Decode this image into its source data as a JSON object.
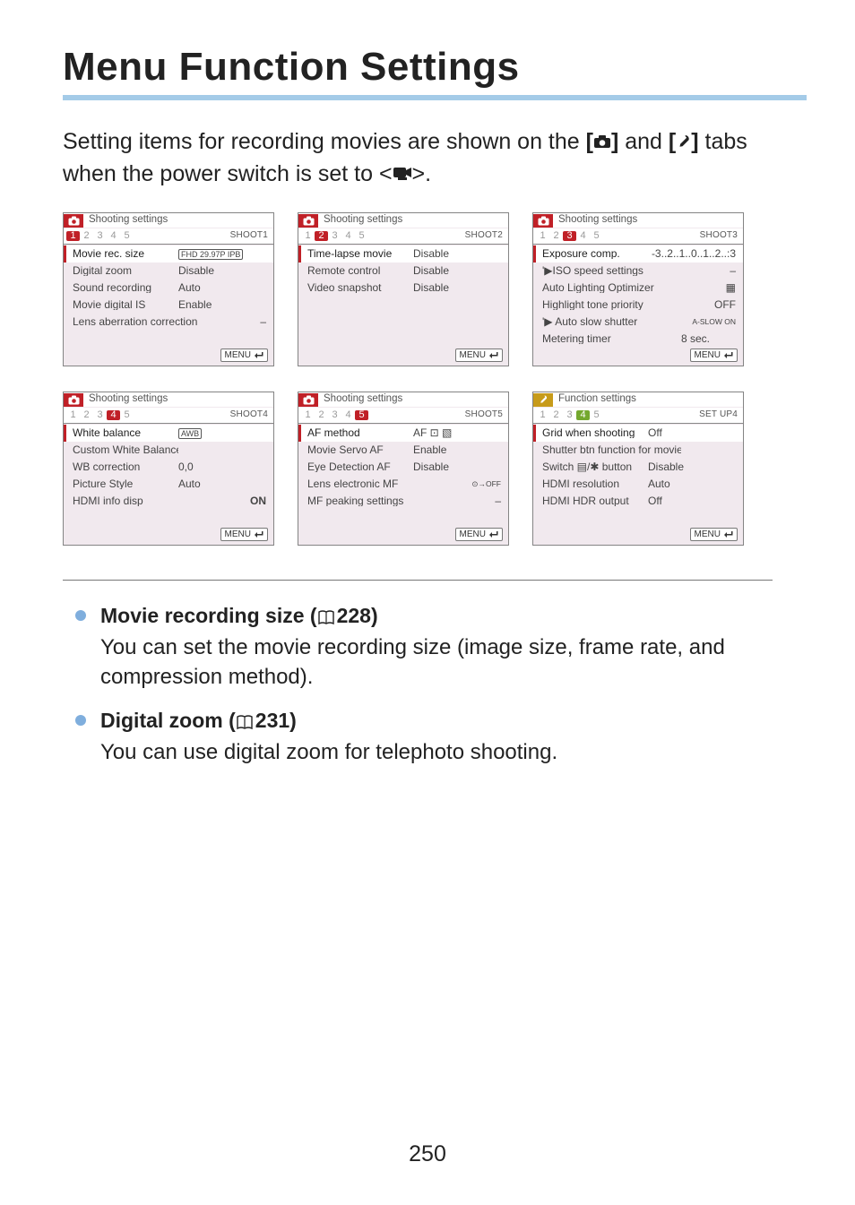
{
  "page_title": "Menu Function Settings",
  "intro": {
    "pre": "Setting items for recording movies are shown on the ",
    "bracket1_open": "[",
    "bracket1_close": "]",
    "mid": " and ",
    "bracket2_open": "[",
    "bracket2_close": "]",
    "after_brackets": " tabs when the power switch is set to <",
    "end": ">."
  },
  "panels": [
    {
      "header_icon_color": "red",
      "header_title": "Shooting settings",
      "active_tab_index": 0,
      "active_tab_style": "sel",
      "tab_label": "SHOOT1",
      "items": [
        {
          "k": "Movie rec. size",
          "v": "FHD 29.97P IPB",
          "v_style": "badge",
          "selected": true
        },
        {
          "k": "Digital zoom",
          "v": "Disable"
        },
        {
          "k": "Sound recording",
          "v": "Auto"
        },
        {
          "k": "Movie digital IS",
          "v": "Enable"
        },
        {
          "k": "Lens aberration correction",
          "v": "–",
          "v_align": "right",
          "wide_key": true
        }
      ],
      "footer": "MENU"
    },
    {
      "header_icon_color": "red",
      "header_title": "Shooting settings",
      "active_tab_index": 1,
      "active_tab_style": "sel",
      "tab_label": "SHOOT2",
      "items": [
        {
          "k": "Time-lapse movie",
          "v": "Disable",
          "selected": true
        },
        {
          "k": "Remote control",
          "v": "Disable"
        },
        {
          "k": "Video snapshot",
          "v": "Disable"
        }
      ],
      "footer": "MENU"
    },
    {
      "header_icon_color": "red",
      "header_title": "Shooting settings",
      "active_tab_index": 2,
      "active_tab_style": "sel",
      "tab_label": "SHOOT3",
      "items": [
        {
          "k": "Exposure comp.",
          "v": "-3..2..1..0..1..2..:3",
          "v_align": "right",
          "selected": true
        },
        {
          "k": "'▶ISO speed settings",
          "v": "–",
          "v_align": "right",
          "wide_key": true
        },
        {
          "k": "Auto Lighting Optimizer",
          "v": "▦",
          "v_align": "right",
          "wide_key": true
        },
        {
          "k": "Highlight tone priority",
          "v": "OFF",
          "v_align": "right",
          "wide_key": true
        },
        {
          "k": "'▶ Auto slow shutter",
          "v": "A-SLOW ON",
          "v_align": "right",
          "v_small": true,
          "wide_key": true
        },
        {
          "k": "Metering timer",
          "v": "8 sec.",
          "wide_key": true
        }
      ],
      "footer": "MENU"
    },
    {
      "header_icon_color": "red",
      "header_title": "Shooting settings",
      "active_tab_index": 3,
      "active_tab_style": "sel",
      "tab_label": "SHOOT4",
      "items": [
        {
          "k": "White balance",
          "v": "AWB",
          "v_style": "badge",
          "selected": true
        },
        {
          "k": "Custom White Balance",
          "v": ""
        },
        {
          "k": "WB correction",
          "v": "0,0"
        },
        {
          "k": "Picture Style",
          "v": "Auto"
        },
        {
          "k": "HDMI info disp",
          "v": "ON",
          "v_align": "right",
          "v_bold": true
        }
      ],
      "footer": "MENU"
    },
    {
      "header_icon_color": "red",
      "header_title": "Shooting settings",
      "active_tab_index": 4,
      "active_tab_style": "sel",
      "tab_label": "SHOOT5",
      "items": [
        {
          "k": "AF method",
          "v": "AF ⊡ ▧",
          "selected": true
        },
        {
          "k": "Movie Servo AF",
          "v": "Enable"
        },
        {
          "k": "Eye Detection AF",
          "v": "Disable"
        },
        {
          "k": "Lens electronic MF",
          "v": "⊙→OFF",
          "v_align": "right",
          "v_small": true
        },
        {
          "k": "MF peaking settings",
          "v": "–",
          "v_align": "right",
          "wide_key": true
        }
      ],
      "footer": "MENU"
    },
    {
      "header_icon_color": "yellow",
      "header_title": "Function settings",
      "active_tab_index": 3,
      "active_tab_style": "sel-green",
      "tab_label": "SET UP4",
      "items": [
        {
          "k": "Grid when shooting",
          "v": "Off",
          "selected": true
        },
        {
          "k": "Shutter btn function for movies",
          "v": "",
          "wide_key": true
        },
        {
          "k": "Switch ▤/✱ button",
          "v": "Disable"
        },
        {
          "k": "HDMI resolution",
          "v": "Auto"
        },
        {
          "k": "HDMI HDR output",
          "v": "Off"
        }
      ],
      "footer": "MENU"
    }
  ],
  "descriptions": [
    {
      "heading_prefix": "Movie recording size (",
      "page_ref": "228",
      "heading_suffix": ")",
      "body": "You can set the movie recording size (image size, frame rate, and compression method)."
    },
    {
      "heading_prefix": "Digital zoom (",
      "page_ref": "231",
      "heading_suffix": ")",
      "body": "You can use digital zoom for telephoto shooting."
    }
  ],
  "page_number": "250",
  "tabs": [
    "1",
    "2",
    "3",
    "4",
    "5"
  ]
}
